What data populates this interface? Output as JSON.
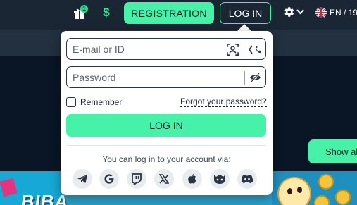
{
  "header": {
    "gift_badge_count": "1",
    "dollar_symbol": "$",
    "registration_label": "REGISTRATION",
    "login_label": "LOG IN",
    "language_label": "EN / 19"
  },
  "hero": {
    "show_all_label": "Show al"
  },
  "login_popover": {
    "email_placeholder": "E-mail or ID",
    "password_placeholder": "Password",
    "remember_label": "Remember",
    "remember_checked": false,
    "forgot_label": "Forgot your password?",
    "submit_label": "LOG IN",
    "via_text": "You can log in to your account via:",
    "social_providers": [
      "telegram-icon",
      "google-icon",
      "twitch-icon",
      "x-icon",
      "apple-icon",
      "steam-icon",
      "discord-icon"
    ]
  },
  "banner": {
    "logo_text": "BIBA"
  },
  "colors": {
    "accent": "#45f2a7",
    "header_bg": "#1b2634",
    "page_bg": "#0e1a2b"
  }
}
